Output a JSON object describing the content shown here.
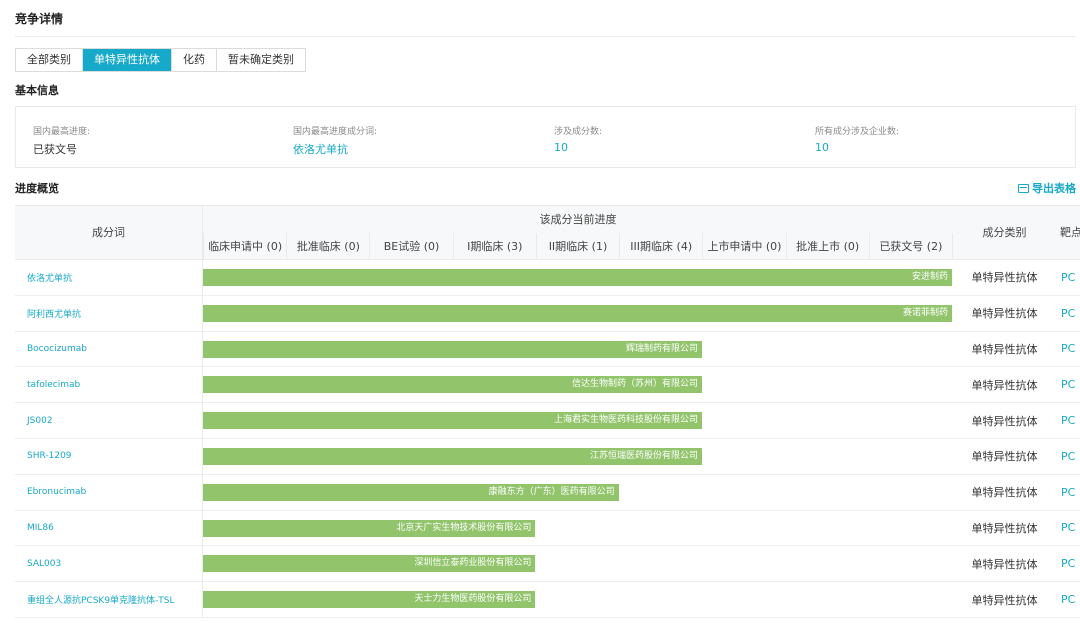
{
  "page_title": "竞争详情",
  "tabs": [
    {
      "label": "全部类别",
      "active": false
    },
    {
      "label": "单特异性抗体",
      "active": true
    },
    {
      "label": "化药",
      "active": false
    },
    {
      "label": "暂未确定类别",
      "active": false
    }
  ],
  "basic_info": {
    "title": "基本信息",
    "items": [
      {
        "label": "国内最高进度:",
        "value": "已获文号"
      },
      {
        "label": "国内最高进度成分词:",
        "value": "依洛尤单抗"
      },
      {
        "label": "涉及成分数:",
        "value": "10"
      },
      {
        "label": "所有成分涉及企业数:",
        "value": "10"
      }
    ]
  },
  "progress": {
    "title": "进度概览",
    "export_label": "导出表格",
    "headers": {
      "name": "成分词",
      "stage_group": "该成分当前进度",
      "category": "成分类别",
      "target": "靶点"
    },
    "stages": [
      "临床申请中 (0)",
      "批准临床 (0)",
      "BE试验 (0)",
      "I期临床 (3)",
      "II期临床 (1)",
      "III期临床 (4)",
      "上市申请中 (0)",
      "批准上市 (0)",
      "已获文号 (2)"
    ],
    "rows": [
      {
        "name": "依洛尤单抗",
        "company": "安进制药",
        "stage_reached": 9,
        "category": "单特异性抗体",
        "target": "PC"
      },
      {
        "name": "阿利西尤单抗",
        "company": "赛诺菲制药",
        "stage_reached": 9,
        "category": "单特异性抗体",
        "target": "PC"
      },
      {
        "name": "Bococizumab",
        "company": "辉瑞制药有限公司",
        "stage_reached": 6,
        "category": "单特异性抗体",
        "target": "PC"
      },
      {
        "name": "tafolecimab",
        "company": "信达生物制药（苏州）有限公司",
        "stage_reached": 6,
        "category": "单特异性抗体",
        "target": "PC"
      },
      {
        "name": "JS002",
        "company": "上海君实生物医药科技股份有限公司",
        "stage_reached": 6,
        "category": "单特异性抗体",
        "target": "PC"
      },
      {
        "name": "SHR-1209",
        "company": "江苏恒瑞医药股份有限公司",
        "stage_reached": 6,
        "category": "单特异性抗体",
        "target": "PC"
      },
      {
        "name": "Ebronucimab",
        "company": "康融东方（广东）医药有限公司",
        "stage_reached": 5,
        "category": "单特异性抗体",
        "target": "PC"
      },
      {
        "name": "MIL86",
        "company": "北京天广实生物技术股份有限公司",
        "stage_reached": 4,
        "category": "单特异性抗体",
        "target": "PC"
      },
      {
        "name": "SAL003",
        "company": "深圳信立泰药业股份有限公司",
        "stage_reached": 4,
        "category": "单特异性抗体",
        "target": "PC"
      },
      {
        "name": "重组全人源抗PCSK9单克隆抗体-TSL",
        "company": "天士力生物医药股份有限公司",
        "stage_reached": 4,
        "category": "单特异性抗体",
        "target": "PC"
      }
    ]
  },
  "colors": {
    "accent": "#17a9c9",
    "bar": "#92c46c"
  }
}
